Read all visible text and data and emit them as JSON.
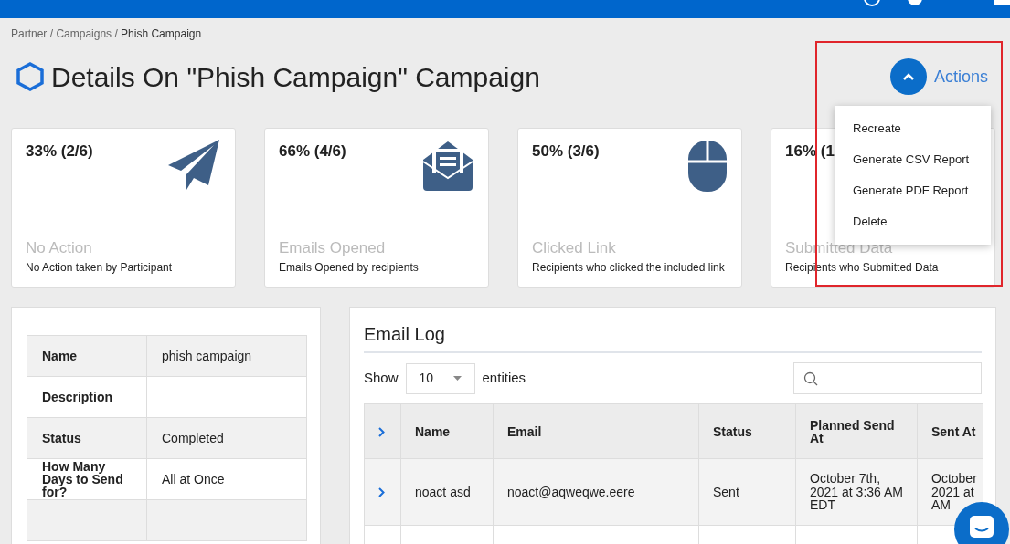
{
  "breadcrumb": [
    {
      "label": "Partner",
      "current": false
    },
    {
      "label": "Campaigns",
      "current": false
    },
    {
      "label": "Phish Campaign",
      "current": true
    }
  ],
  "breadcrumb_separators": [
    "/",
    "/"
  ],
  "title": "Details On \"Phish Campaign\" Campaign",
  "actions": {
    "label": "Actions",
    "expanded": true,
    "menu": [
      "Recreate",
      "Generate CSV Report",
      "Generate PDF Report",
      "Delete"
    ]
  },
  "stats": [
    {
      "value": "33% (2/6)",
      "label": "No Action",
      "caption": "No Action taken by Participant",
      "kind": "plane"
    },
    {
      "value": "66% (4/6)",
      "label": "Emails Opened",
      "caption": "Emails Opened by recipients",
      "kind": "envelope"
    },
    {
      "value": "50% (3/6)",
      "label": "Clicked Link",
      "caption": "Recipients who clicked the included link",
      "kind": "mouse"
    },
    {
      "value": "16% (1",
      "label": "Submitted Data",
      "caption": "Recipients who Submitted Data",
      "kind": "none"
    }
  ],
  "details": [
    {
      "label": "Name",
      "value": "phish campaign"
    },
    {
      "label": "Description"
    },
    {
      "label": "Status",
      "value": "Completed"
    },
    {
      "label": "How Many Days to Send for?",
      "value": "All at Once"
    }
  ],
  "email_log": {
    "title": "Email Log",
    "show_label": "Show",
    "page_size": "10",
    "entities_label": "entities",
    "columns": [
      "Name",
      "Email",
      "Status",
      "Planned Send At",
      "Sent At"
    ],
    "rows": [
      {
        "name": "noact asd",
        "email": "noact@aqweqwe.eere",
        "status": "Sent",
        "planned": "October 7th,\n2021 at 3:36 AM\nEDT",
        "sent": "October\n2021 at\nAM"
      },
      {}
    ]
  }
}
